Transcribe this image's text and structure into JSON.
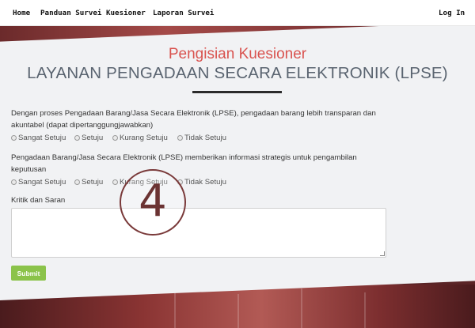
{
  "nav": {
    "items": [
      "Home",
      "Panduan Survei Kuesioner",
      "Laporan Survei"
    ],
    "login": "Log In"
  },
  "header": {
    "subtitle": "Pengisian Kuesioner",
    "title": "LAYANAN PENGADAAN SECARA ELEKTRONIK (LPSE)"
  },
  "questions": [
    {
      "text": "Dengan proses Pengadaan Barang/Jasa Secara Elektronik (LPSE), pengadaan barang lebih transparan dan akuntabel (dapat dipertanggungjawabkan)",
      "options": [
        "Sangat Setuju",
        "Setuju",
        "Kurang Setuju",
        "Tidak Setuju"
      ]
    },
    {
      "text": "Pengadaan Barang/Jasa Secara Elektronik (LPSE) memberikan informasi strategis untuk pengambilan keputusan",
      "options": [
        "Sangat Setuju",
        "Setuju",
        "Kurang Setuju",
        "Tidak Setuju"
      ]
    }
  ],
  "feedback": {
    "label": "Kritik dan Saran",
    "value": ""
  },
  "submit_label": "Submit",
  "overlay_badge": "4",
  "colors": {
    "accent_red": "#d9534f",
    "submit_green": "#8bc34a",
    "title_gray": "#5a6470"
  }
}
